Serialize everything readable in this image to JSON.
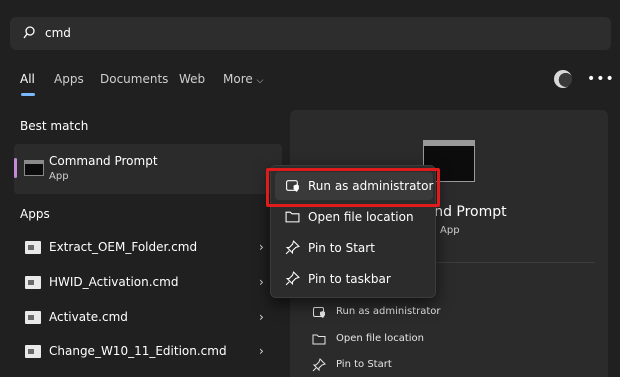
{
  "search": {
    "value": "cmd",
    "icon": "search-icon"
  },
  "tabs": [
    {
      "label": "All",
      "active": true
    },
    {
      "label": "Apps",
      "active": false
    },
    {
      "label": "Documents",
      "active": false
    },
    {
      "label": "Web",
      "active": false
    },
    {
      "label": "More",
      "active": false
    }
  ],
  "more_chevron": "⌵",
  "more_options_glyph": "•••",
  "best_match": {
    "section_label": "Best match",
    "title": "Command Prompt",
    "subtitle": "App"
  },
  "apps_section": {
    "label": "Apps",
    "items": [
      {
        "name": "Extract_OEM_Folder.cmd"
      },
      {
        "name": "HWID_Activation.cmd"
      },
      {
        "name": "Activate.cmd"
      },
      {
        "name": "Change_W10_11_Edition.cmd"
      }
    ],
    "chevron": "›"
  },
  "context_menu": {
    "items": [
      {
        "label": "Run as administrator",
        "icon": "shield-icon"
      },
      {
        "label": "Open file location",
        "icon": "folder-icon"
      },
      {
        "label": "Pin to Start",
        "icon": "pin-icon"
      },
      {
        "label": "Pin to taskbar",
        "icon": "pin-icon"
      }
    ]
  },
  "detail_panel": {
    "title": "Command Prompt",
    "subtitle": "App",
    "actions": [
      {
        "label": "Run as administrator",
        "icon": "shield-icon"
      },
      {
        "label": "Open file location",
        "icon": "folder-icon"
      },
      {
        "label": "Pin to Start",
        "icon": "pin-icon"
      }
    ]
  },
  "colors": {
    "background": "#202020",
    "accent": "#7ab8ff",
    "highlight": "#e01b1b"
  }
}
